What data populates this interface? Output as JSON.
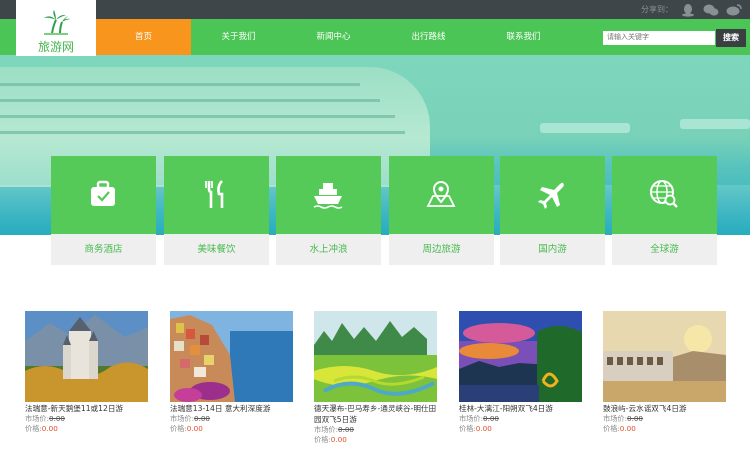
{
  "top_bar": {
    "share_label": "分享到："
  },
  "logo": {
    "text": "旅游网"
  },
  "nav": {
    "items": [
      {
        "label": "首页",
        "active": true
      },
      {
        "label": "关于我们",
        "active": false
      },
      {
        "label": "新闻中心",
        "active": false
      },
      {
        "label": "出行路线",
        "active": false
      },
      {
        "label": "联系我们",
        "active": false
      }
    ]
  },
  "search": {
    "placeholder": "请输入关键字",
    "button_label": "搜索"
  },
  "categories": [
    {
      "label": "商务酒店",
      "icon": "suitcase-icon"
    },
    {
      "label": "美味餐饮",
      "icon": "fork-knife-icon"
    },
    {
      "label": "水上冲浪",
      "icon": "ship-icon"
    },
    {
      "label": "周边旅游",
      "icon": "map-pin-icon"
    },
    {
      "label": "国内游",
      "icon": "airplane-icon"
    },
    {
      "label": "全球游",
      "icon": "globe-search-icon"
    }
  ],
  "products": [
    {
      "title": "法瑞意-新天鹅堡11或12日游",
      "market_label": "市场价:",
      "market_price": "0.00",
      "price_label": "价格:",
      "price": "0.00"
    },
    {
      "title": "法瑞意13-14日 意大利深度游",
      "market_label": "市场价:",
      "market_price": "0.00",
      "price_label": "价格:",
      "price": "0.00"
    },
    {
      "title": "德天瀑布-巴马寿乡-通灵峡谷-明仕田园双飞5日游",
      "market_label": "市场价:",
      "market_price": "0.00",
      "price_label": "价格:",
      "price": "0.00"
    },
    {
      "title": "桂林-大漓江-阳朔双飞4日游",
      "market_label": "市场价:",
      "market_price": "0.00",
      "price_label": "价格:",
      "price": "0.00"
    },
    {
      "title": "鼓浪屿-云水谣双飞4日游",
      "market_label": "市场价:",
      "market_price": "0.00",
      "price_label": "价格:",
      "price": "0.00"
    }
  ],
  "colors": {
    "brand_green": "#4bc555",
    "active_orange": "#f7951d",
    "price_red": "#e24a2a",
    "top_bar": "#3f464a"
  }
}
